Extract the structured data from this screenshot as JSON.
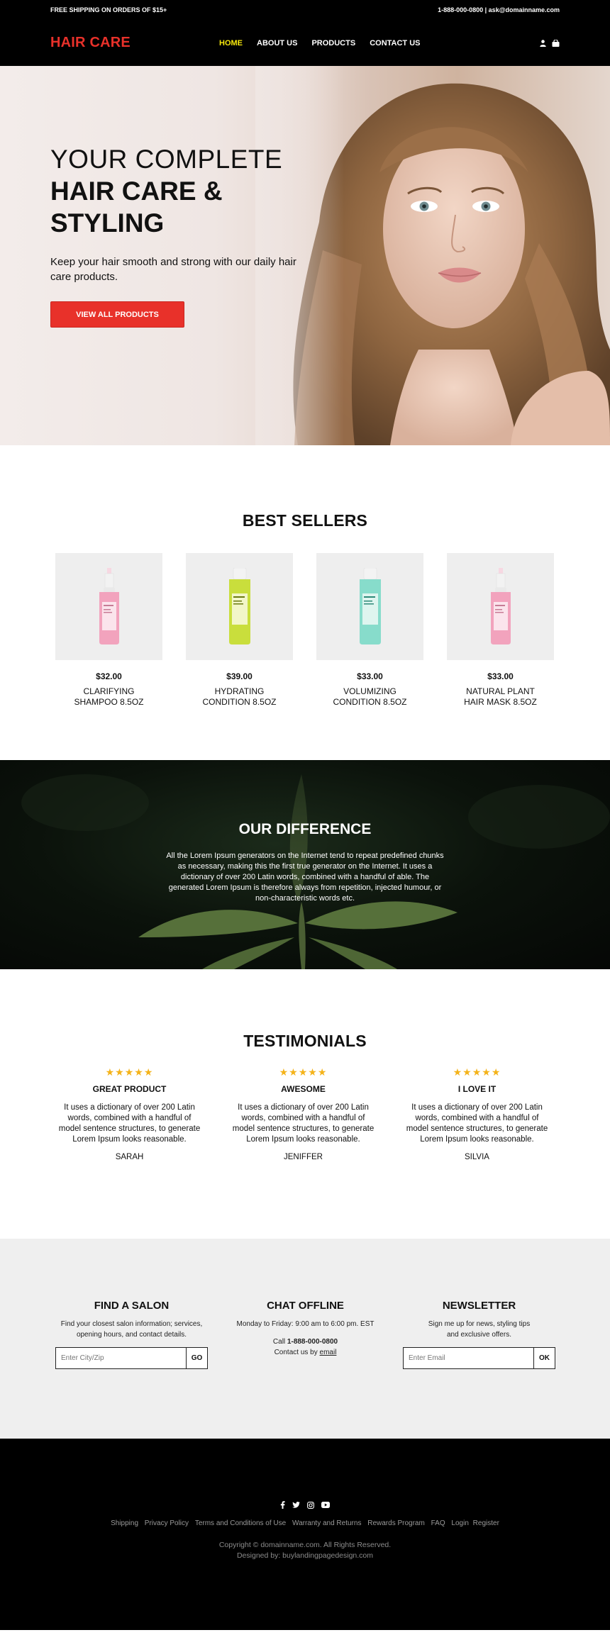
{
  "topbar": {
    "promo": "FREE SHIPPING ON ORDERS OF $15+",
    "contact": "1-888-000-0800 | ask@domainname.com"
  },
  "header": {
    "logo": "HAIR CARE",
    "nav": [
      "HOME",
      "ABOUT US",
      "PRODUCTS",
      "CONTACT US"
    ],
    "active_nav": "HOME",
    "icons": [
      "user-icon",
      "cart-icon"
    ]
  },
  "hero": {
    "line1": "YOUR COMPLETE",
    "line2": "HAIR CARE &",
    "line3": "STYLING",
    "description": "Keep your hair smooth and strong with our daily hair care products.",
    "button": "VIEW ALL PRODUCTS"
  },
  "best_sellers": {
    "title": "BEST SELLERS",
    "products": [
      {
        "price": "$32.00",
        "name1": "CLARIFYING",
        "name2": "SHAMPOO 8.5OZ",
        "bottle_color": "#f2a3bd",
        "type": "dropper"
      },
      {
        "price": "$39.00",
        "name1": "HYDRATING",
        "name2": "CONDITION 8.5OZ",
        "bottle_color": "#c9de3c",
        "type": "bottle"
      },
      {
        "price": "$33.00",
        "name1": "VOLUMIZING",
        "name2": "CONDITION 8.5OZ",
        "bottle_color": "#87dccb",
        "type": "bottle"
      },
      {
        "price": "$33.00",
        "name1": "NATURAL PLANT",
        "name2": "HAIR MASK 8.5OZ",
        "bottle_color": "#f2a3bd",
        "type": "dropper"
      }
    ]
  },
  "difference": {
    "title": "OUR DIFFERENCE",
    "text": "All the Lorem Ipsum generators on the Internet tend to repeat predefined chunks as necessary, making this the first true generator on the Internet. It uses a dictionary of over 200 Latin words, combined with a handful of able. The generated Lorem Ipsum is therefore always from repetition, injected humour, or non-characteristic words etc."
  },
  "testimonials": {
    "title": "TESTIMONIALS",
    "stars": "★★★★★",
    "items": [
      {
        "heading": "GREAT PRODUCT",
        "text": "It uses a dictionary of over 200 Latin words, combined with a handful of model sentence structures, to generate Lorem Ipsum looks reasonable.",
        "name": "SARAH"
      },
      {
        "heading": "AWESOME",
        "text": "It uses a dictionary of over 200 Latin words, combined with a handful of model sentence structures, to generate Lorem Ipsum looks reasonable.",
        "name": "JENIFFER"
      },
      {
        "heading": "I LOVE IT",
        "text": "It uses a dictionary of over 200 Latin words, combined with a handful of model sentence structures, to generate Lorem Ipsum looks reasonable.",
        "name": "SILVIA"
      }
    ]
  },
  "info": {
    "salon": {
      "title": "FIND A SALON",
      "text": "Find your closest salon information; services, opening hours, and contact details.",
      "placeholder": "Enter City/Zip",
      "button": "GO"
    },
    "chat": {
      "title": "CHAT OFFLINE",
      "hours": "Monday to Friday: 9:00 am to 6:00 pm. EST",
      "call_prefix": "Call",
      "phone": "1-888-000-0800",
      "contact_prefix": "Contact us by",
      "email_link": "email"
    },
    "newsletter": {
      "title": "NEWSLETTER",
      "text": "Sign me up for news, styling tips and exclusive offers.",
      "placeholder": "Enter Email",
      "button": "OK"
    }
  },
  "footer": {
    "social_icons": [
      "facebook-icon",
      "twitter-icon",
      "instagram-icon",
      "youtube-icon"
    ],
    "links": [
      "Shipping",
      "Privacy Policy",
      "Terms and Conditions of Use",
      "Warranty and Returns",
      "Rewards Program",
      "FAQ",
      "Login",
      "Register"
    ],
    "copyright": "Copyright © domainname.com. All Rights Reserved.",
    "designed_by": "Designed by: buylandingpagedesign.com"
  },
  "colors": {
    "accent_red": "#e8312a",
    "nav_active": "#f7e80c",
    "star": "#f4b31a"
  }
}
